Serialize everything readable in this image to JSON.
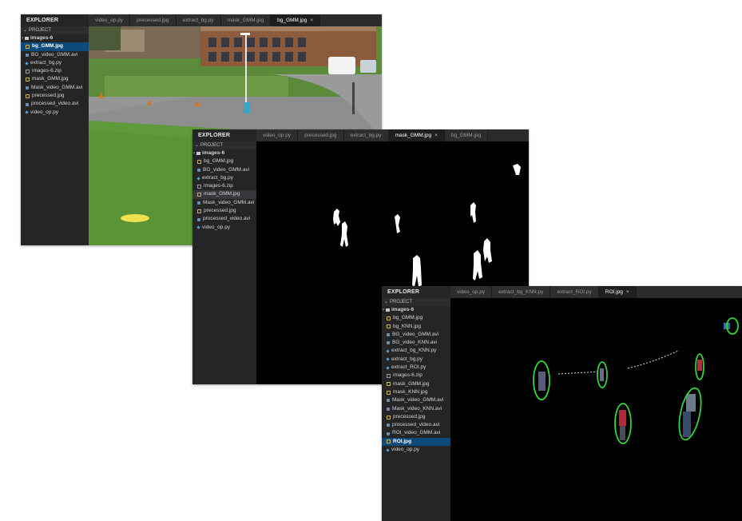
{
  "windows": [
    {
      "explorer_title": "EXPLORER",
      "project_label": "PROJECT",
      "files": [
        {
          "name": "images-6",
          "type": "folder"
        },
        {
          "name": "bg_GMM.jpg",
          "type": "jpg",
          "selected": true
        },
        {
          "name": "BG_video_GMM.avi",
          "type": "avi"
        },
        {
          "name": "extract_bg.py",
          "type": "py"
        },
        {
          "name": "images-6.zip",
          "type": "zip"
        },
        {
          "name": "mask_GMM.jpg",
          "type": "jpg"
        },
        {
          "name": "Mask_video_GMM.avi",
          "type": "avi"
        },
        {
          "name": "precessed.jpg",
          "type": "jpg"
        },
        {
          "name": "processed_video.avi",
          "type": "avi"
        },
        {
          "name": "video_op.py",
          "type": "py"
        }
      ],
      "tabs": [
        {
          "label": "video_op.py"
        },
        {
          "label": "precessed.jpg"
        },
        {
          "label": "extract_bg.py"
        },
        {
          "label": "mask_GMM.jpg"
        },
        {
          "label": "bg_GMM.jpg",
          "active": true
        }
      ],
      "close_glyph": "×"
    },
    {
      "explorer_title": "EXPLORER",
      "project_label": "PROJECT",
      "files": [
        {
          "name": "images-6",
          "type": "folder"
        },
        {
          "name": "bg_GMM.jpg",
          "type": "jpg"
        },
        {
          "name": "BG_video_GMM.avi",
          "type": "avi"
        },
        {
          "name": "extract_bg.py",
          "type": "py"
        },
        {
          "name": "images-6.zip",
          "type": "zip"
        },
        {
          "name": "mask_GMM.jpg",
          "type": "jpg",
          "highlighted": true
        },
        {
          "name": "Mask_video_GMM.avi",
          "type": "avi"
        },
        {
          "name": "precessed.jpg",
          "type": "jpg"
        },
        {
          "name": "processed_video.avi",
          "type": "avi"
        },
        {
          "name": "video_op.py",
          "type": "py"
        }
      ],
      "tabs": [
        {
          "label": "video_op.py"
        },
        {
          "label": "precessed.jpg"
        },
        {
          "label": "extract_bg.py"
        },
        {
          "label": "mask_GMM.jpg",
          "active": true
        },
        {
          "label": "bg_GMM.jpg"
        }
      ],
      "close_glyph": "×"
    },
    {
      "explorer_title": "EXPLORER",
      "project_label": "PROJECT",
      "files": [
        {
          "name": "images-6",
          "type": "folder"
        },
        {
          "name": "bg_GMM.jpg",
          "type": "jpg"
        },
        {
          "name": "bg_KNN.jpg",
          "type": "jpg"
        },
        {
          "name": "BG_video_GMM.avi",
          "type": "avi"
        },
        {
          "name": "BG_video_KNN.avi",
          "type": "avi"
        },
        {
          "name": "extract_bg_KNN.py",
          "type": "py"
        },
        {
          "name": "extract_bg.py",
          "type": "py"
        },
        {
          "name": "extract_ROI.py",
          "type": "py"
        },
        {
          "name": "images-6.zip",
          "type": "zip"
        },
        {
          "name": "mask_GMM.jpg",
          "type": "jpg"
        },
        {
          "name": "mask_KNN.jpg",
          "type": "jpg"
        },
        {
          "name": "Mask_video_GMM.avi",
          "type": "avi"
        },
        {
          "name": "Mask_video_KNN.avi",
          "type": "avi"
        },
        {
          "name": "precessed.jpg",
          "type": "jpg"
        },
        {
          "name": "processed_video.avi",
          "type": "avi"
        },
        {
          "name": "ROI_video_GMM.avi",
          "type": "avi"
        },
        {
          "name": "ROI.jpg",
          "type": "jpg",
          "selected": true
        },
        {
          "name": "video_op.py",
          "type": "py"
        }
      ],
      "tabs": [
        {
          "label": "video_op.py"
        },
        {
          "label": "extract_bg_KNN.py"
        },
        {
          "label": "extract_ROI.py"
        },
        {
          "label": "ROI.jpg",
          "active": true
        }
      ],
      "close_glyph": "×"
    }
  ]
}
